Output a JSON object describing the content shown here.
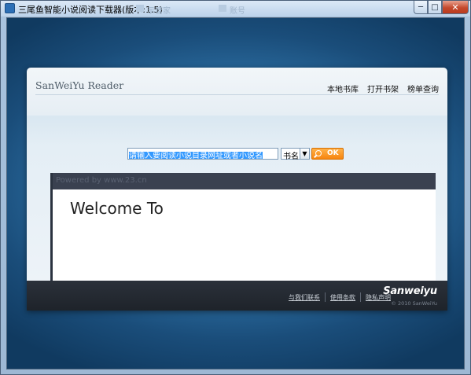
{
  "window": {
    "title": "三尾鱼智能小说阅读下载器(版本:1.5)",
    "background_ghost_items": [
      "示管家",
      "账号"
    ],
    "controls": {
      "minimize": "─",
      "maximize": "□",
      "close": "✕"
    }
  },
  "page": {
    "brand": "SanWeiYu Reader",
    "nav": [
      "本地书库",
      "打开书架",
      "榜单查询"
    ],
    "search": {
      "input_value": "请输入要阅读小说目录网址或者小说名",
      "type_selected": "书名",
      "submit_label": "OK"
    },
    "content": {
      "powered_by": "Powered by www.23.cn",
      "welcome": "Welcome To"
    },
    "footer": {
      "links": [
        "与我们联系",
        "使用条款",
        "隐私声明"
      ],
      "logo": "Sanweiyu",
      "copyright": "© 2010 SanWeiYu"
    }
  },
  "colors": {
    "ok_button": "#f7850f",
    "selection": "#3399ff",
    "footer_bg": "#23282f"
  }
}
